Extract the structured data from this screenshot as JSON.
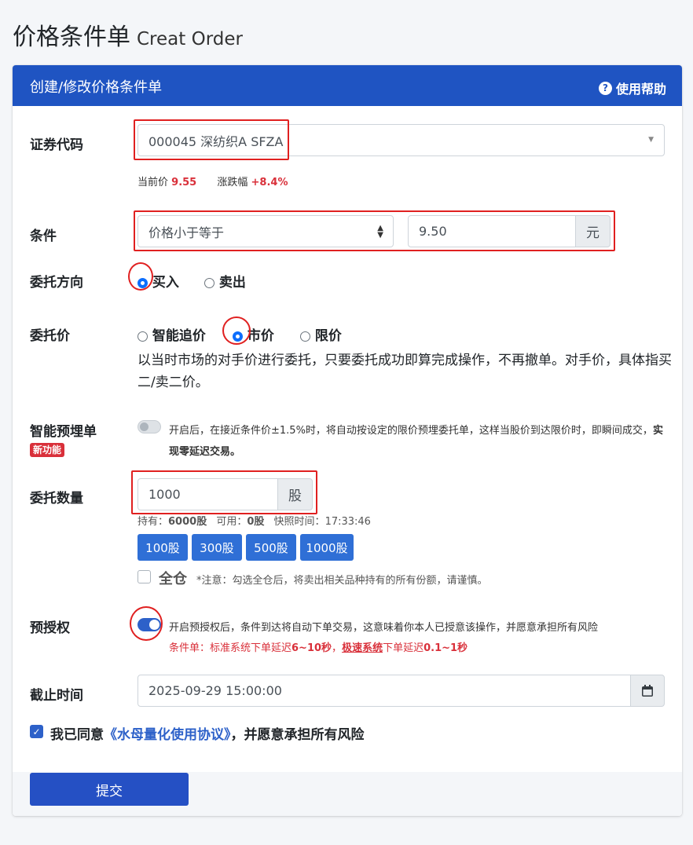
{
  "page": {
    "title": "价格条件单",
    "subtitle": "Creat Order"
  },
  "card": {
    "title": "创建/修改价格条件单",
    "help_label": "使用帮助",
    "help_icon": "question-circle-icon"
  },
  "stock": {
    "label": "证券代码",
    "value": "000045 深纺织A SFZA",
    "current_price_label": "当前价",
    "current_price": "9.55",
    "change_label": "涨跌幅",
    "change": "+8.4%"
  },
  "condition": {
    "label": "条件",
    "operator": "价格小于等于",
    "price": "9.50",
    "unit": "元"
  },
  "direction": {
    "label": "委托方向",
    "options": [
      "买入",
      "卖出"
    ],
    "selected": "买入"
  },
  "order_price": {
    "label": "委托价",
    "options": [
      "智能追价",
      "市价",
      "限价"
    ],
    "selected": "市价",
    "description": "以当时市场的对手价进行委托，只要委托成功即算完成操作，不再撤单。对手价，具体指买二/卖二价。"
  },
  "smart_preorder": {
    "label": "智能预埋单",
    "badge": "新功能",
    "enabled": false,
    "description": "开启后，在接近条件价±1.5%时，将自动按设定的限价预埋委托单，这样当股价到达限价时，即瞬间成",
    "description_cont": "交，",
    "description_strong": "实现零延迟交易。"
  },
  "quantity": {
    "label": "委托数量",
    "value": "1000",
    "unit": "股",
    "hold_label": "持有：",
    "hold_value": "6000股",
    "avail_label": "可用：",
    "avail_value": "0股",
    "snapshot_label": "快照时间：",
    "snapshot_time": "17:33:46",
    "presets": [
      "100股",
      "300股",
      "500股",
      "1000股"
    ],
    "all_label": "全仓",
    "all_note": "*注意：勾选全仓后，将卖出相关品种持有的所有份额，请谨慎。"
  },
  "preauth": {
    "label": "预授权",
    "enabled": true,
    "description": "开启预授权后，条件到达将自动下单交易，这意味着你本人已授意该操作，并愿意承担所有风险",
    "latency_prefix": "条件单：标准系统下单延迟",
    "latency_std": "6~10秒",
    "latency_sep": "，",
    "fast_link": "极速系统",
    "latency_mid": "下单延迟",
    "latency_fast": "0.1~1秒"
  },
  "deadline": {
    "label": "截止时间",
    "value": "2025-09-29 15:00:00",
    "icon": "calendar-icon"
  },
  "agreement": {
    "checked": true,
    "prefix": "我已同意",
    "link": "《水母量化使用协议》",
    "suffix": "，并愿意承担所有风险"
  },
  "submit_label": "提交",
  "colors": {
    "primary": "#1f54c2",
    "accent": "#2f6fd6",
    "danger": "#d9303a",
    "highlight": "#e02020"
  }
}
